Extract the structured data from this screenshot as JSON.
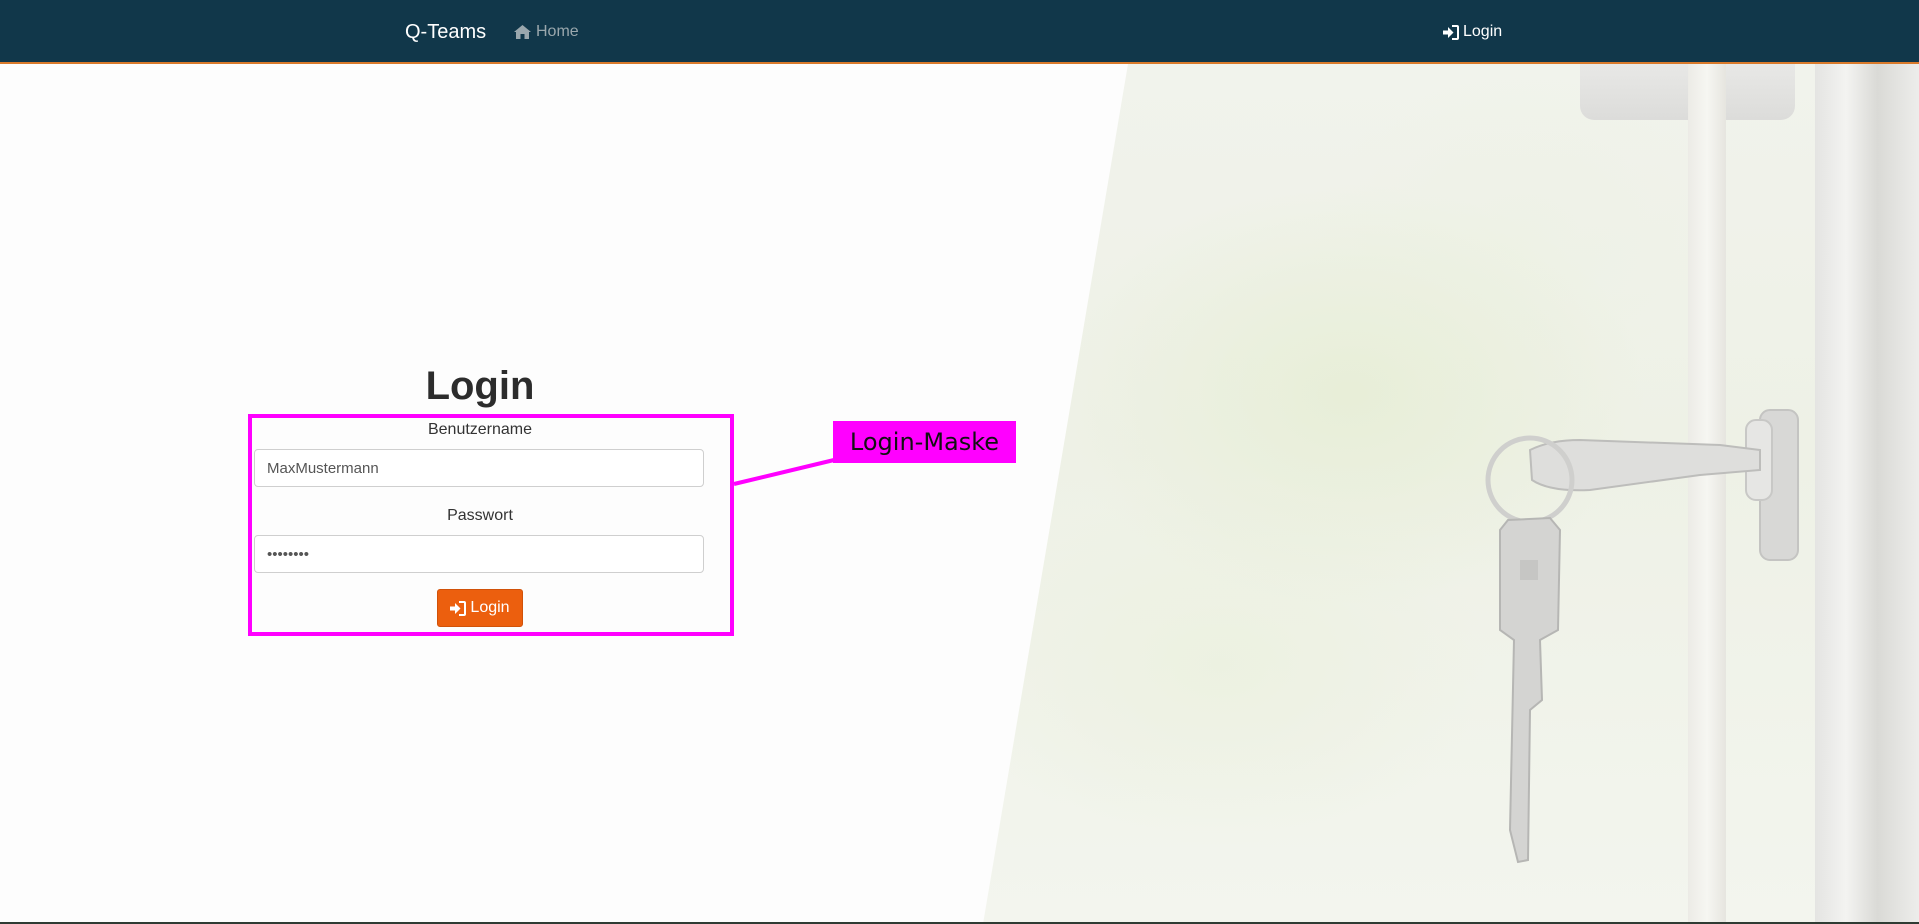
{
  "navbar": {
    "brand": "Q-Teams",
    "home_label": "Home",
    "home_icon": "home-icon",
    "login_label": "Login",
    "login_icon": "sign-in-icon"
  },
  "login": {
    "title": "Login",
    "username_label": "Benutzername",
    "username_value": "MaxMustermann",
    "password_label": "Passwort",
    "password_value": "********",
    "submit_label": "Login",
    "submit_icon": "sign-in-icon"
  },
  "annotation": {
    "label": "Login-Maske",
    "color": "#ff00ff"
  },
  "colors": {
    "navbar_bg": "#11374a",
    "accent": "#ec5f0e"
  }
}
